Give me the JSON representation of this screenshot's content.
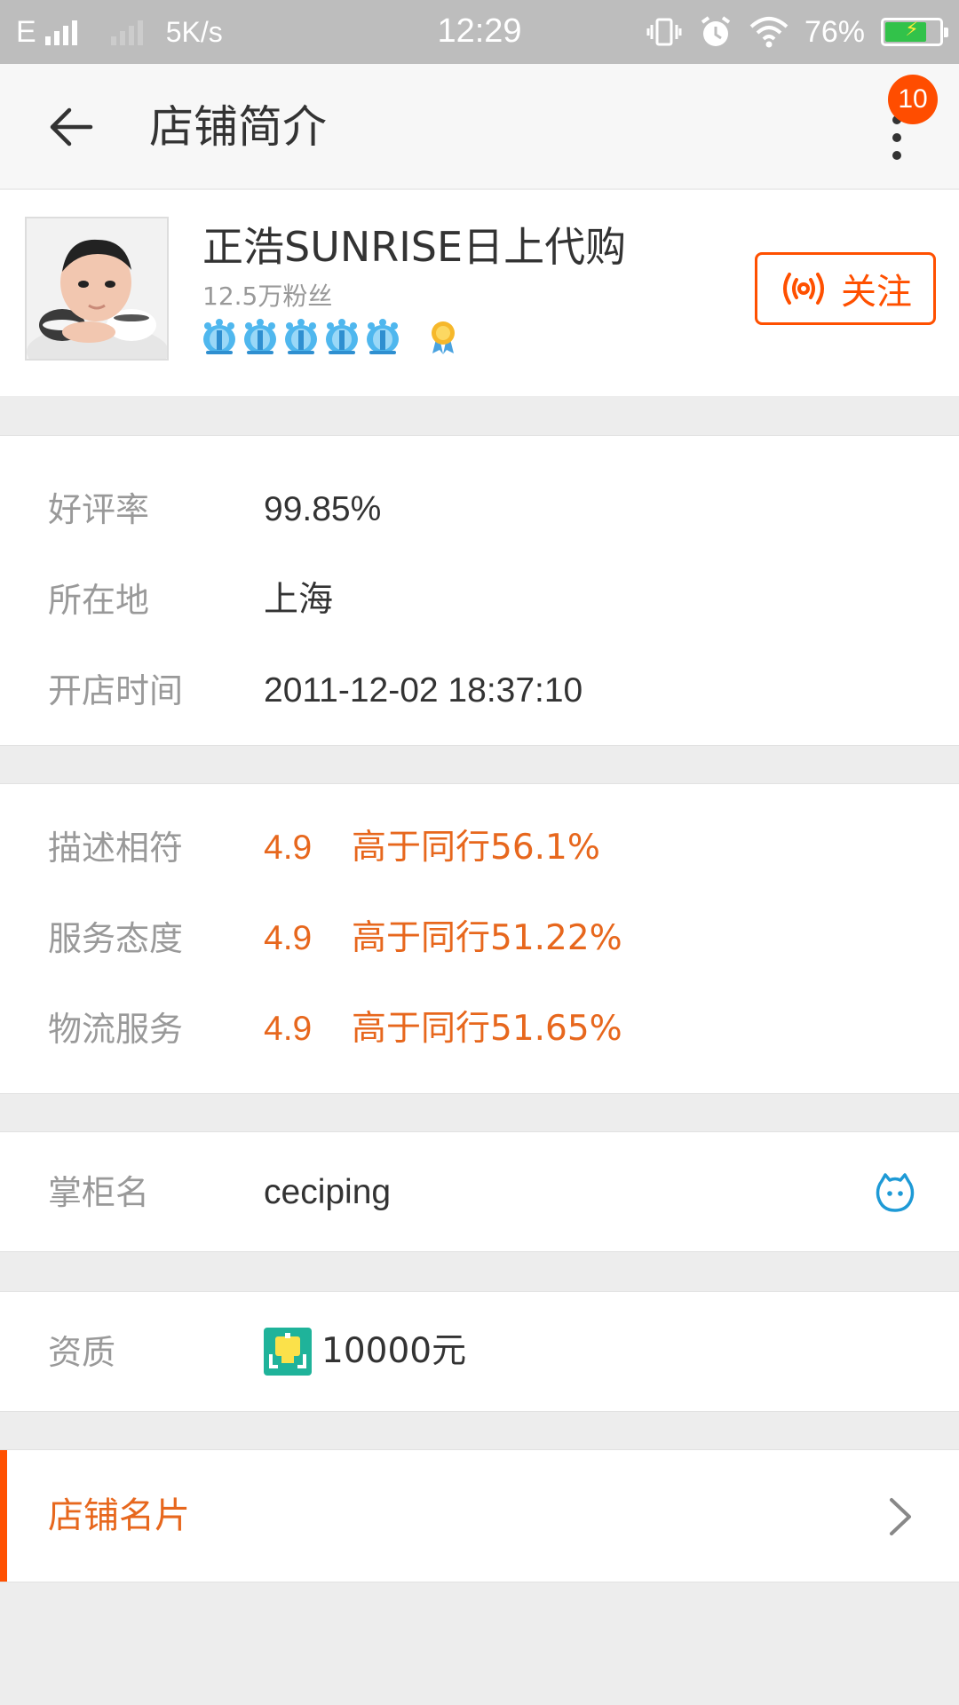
{
  "status_bar": {
    "network": "E",
    "speed": "5K/s",
    "time": "12:29",
    "battery": "76%",
    "battery_level": 0.76
  },
  "header": {
    "title": "店铺简介",
    "badge_count": "10"
  },
  "shop": {
    "name": "正浩SUNRISE日上代购",
    "fans": "12.5万粉丝",
    "crown_count": 5,
    "follow_label": "关注"
  },
  "basic_info": [
    {
      "label": "好评率",
      "value": "99.85%"
    },
    {
      "label": "所在地",
      "value": "上海"
    },
    {
      "label": "开店时间",
      "value": "2011-12-02 18:37:10"
    }
  ],
  "ratings": [
    {
      "label": "描述相符",
      "score": "4.9",
      "compare": "高于同行56.1%"
    },
    {
      "label": "服务态度",
      "score": "4.9",
      "compare": "高于同行51.22%"
    },
    {
      "label": "物流服务",
      "score": "4.9",
      "compare": "高于同行51.65%"
    }
  ],
  "owner": {
    "label": "掌柜名",
    "value": "ceciping"
  },
  "qualification": {
    "label": "资质",
    "value": "10000元"
  },
  "shop_card": {
    "label": "店铺名片"
  },
  "colors": {
    "accent": "#ff5000",
    "rating_text": "#e7671d",
    "label_gray": "#999999",
    "background": "#ededed"
  }
}
